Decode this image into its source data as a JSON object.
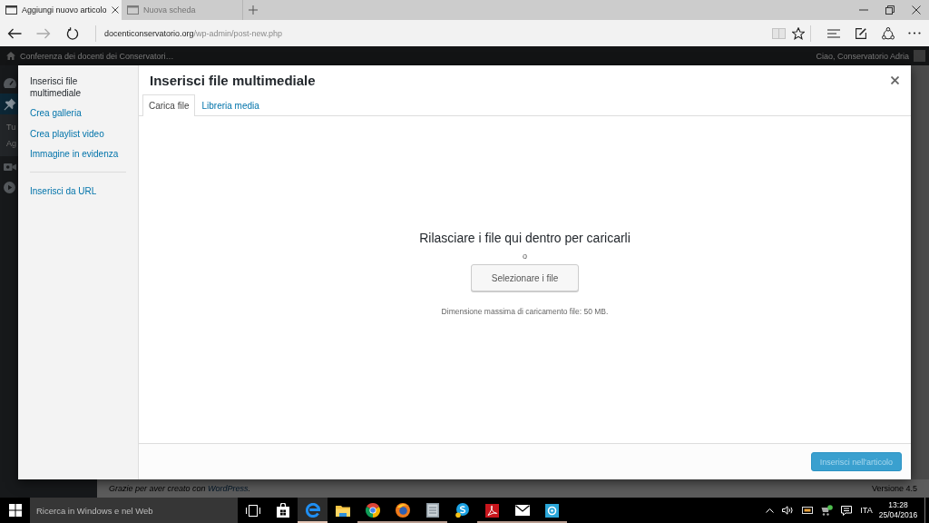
{
  "browser": {
    "tabs": [
      {
        "title": "Aggiungi nuovo articolo",
        "selected": true
      },
      {
        "title": "Nuova scheda",
        "selected": false
      }
    ],
    "address": {
      "domain": "docenticonservatorio.org",
      "path": "/wp-admin/post-new.php"
    }
  },
  "admin_bar": {
    "site_name": "Conferenza dei docenti dei Conservatori…",
    "greeting": "Ciao, Conservatorio Adria"
  },
  "admin_menu": [
    {
      "selected": false
    },
    {
      "selected": true,
      "children": [
        {
          "label": "Tu"
        },
        {
          "label": "Ag"
        }
      ]
    },
    {
      "selected": false
    },
    {
      "selected": false
    }
  ],
  "modal": {
    "title": "Inserisci file multimediale",
    "sidebar": [
      {
        "items": [
          {
            "label": "Inserisci file multimediale",
            "selected": true
          },
          {
            "label": "Crea galleria",
            "selected": false
          },
          {
            "label": "Crea playlist video",
            "selected": false
          },
          {
            "label": "Immagine in evidenza",
            "selected": false
          }
        ]
      },
      {
        "items": [
          {
            "label": "Inserisci da URL",
            "selected": false
          }
        ]
      }
    ],
    "tabs": [
      {
        "label": "Carica file",
        "selected": true
      },
      {
        "label": "Libreria media",
        "selected": false
      }
    ],
    "uploader": {
      "instructions": "Rilasciare i file qui dentro per caricarli",
      "separator": "o",
      "button": "Selezionare i file",
      "max_size": "Dimensione massima di caricamento file: 50 MB."
    },
    "insert_button": {
      "label": "Inserisci nell'articolo",
      "disabled": true
    }
  },
  "page_footer": {
    "thanks": "Grazie per aver creato con",
    "link": "WordPress",
    "end": ".",
    "version": "Versione 4.5"
  },
  "taskbar": {
    "search": {
      "placeholder": "Ricerca in Windows e nel Web"
    },
    "apps": [
      {
        "running": false,
        "selected": false
      },
      {
        "running": true,
        "selected": true
      },
      {
        "running": false,
        "selected": false
      },
      {
        "running": true,
        "selected": false
      },
      {
        "running": true,
        "selected": false
      },
      {
        "running": true,
        "selected": false
      },
      {
        "running": false,
        "selected": false
      },
      {
        "running": true,
        "selected": false
      },
      {
        "running": true,
        "selected": false
      },
      {
        "running": true,
        "selected": false
      }
    ],
    "tray": {
      "language": "ITA",
      "time": "13:28",
      "date": "25/04/2016"
    }
  }
}
